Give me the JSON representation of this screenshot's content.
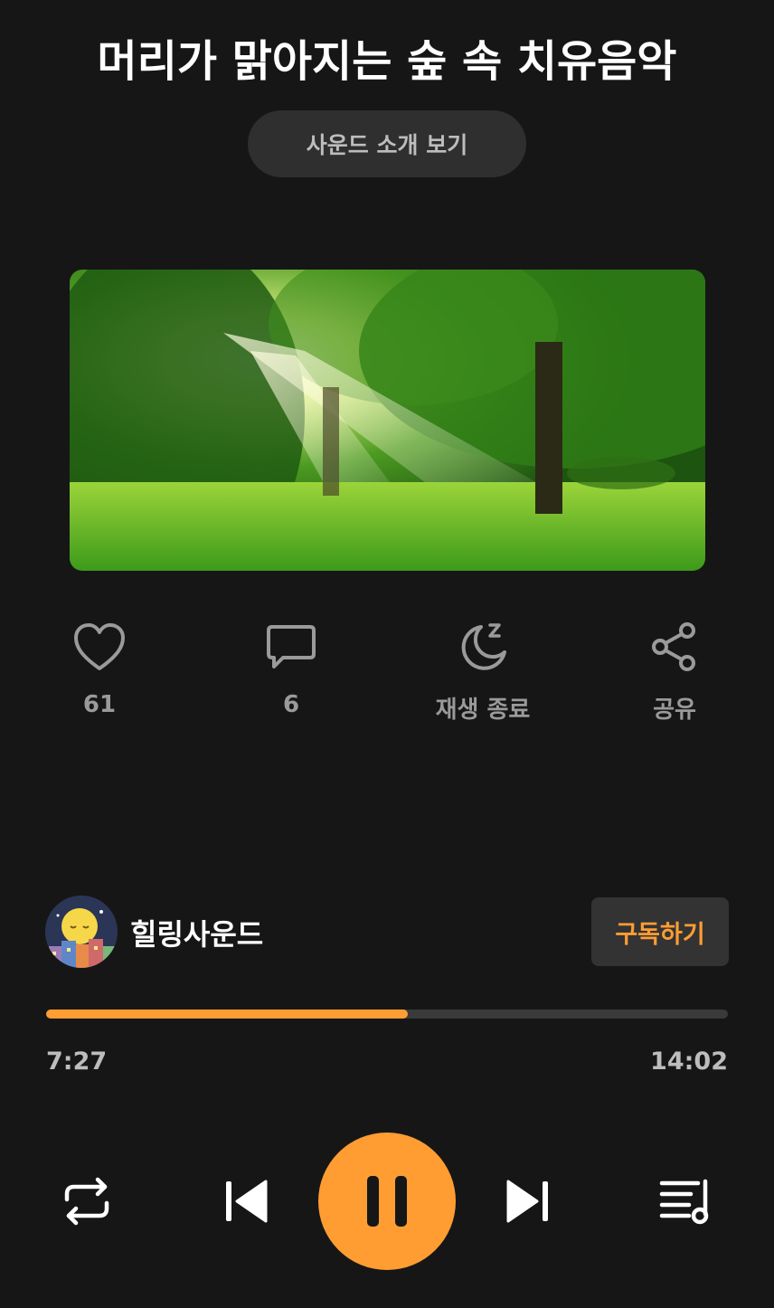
{
  "header": {
    "title": "머리가 맑아지는 숲 속 치유음악",
    "intro_button": "사운드 소개 보기"
  },
  "cover": {
    "image": "forest-sunlight-image"
  },
  "actions": {
    "like_count": "61",
    "comment_count": "6",
    "sleep_timer_label": "재생 종료",
    "share_label": "공유"
  },
  "channel": {
    "name": "힐링사운드",
    "subscribe_label": "구독하기"
  },
  "player": {
    "current_time": "7:27",
    "total_time": "14:02",
    "progress": 0.53,
    "state": "playing"
  },
  "colors": {
    "accent": "#ff9d33",
    "background": "#161616"
  },
  "icons": [
    "heart-icon",
    "comment-icon",
    "moon-icon",
    "share-icon",
    "repeat-icon",
    "previous-icon",
    "pause-icon",
    "next-icon",
    "playlist-icon"
  ]
}
